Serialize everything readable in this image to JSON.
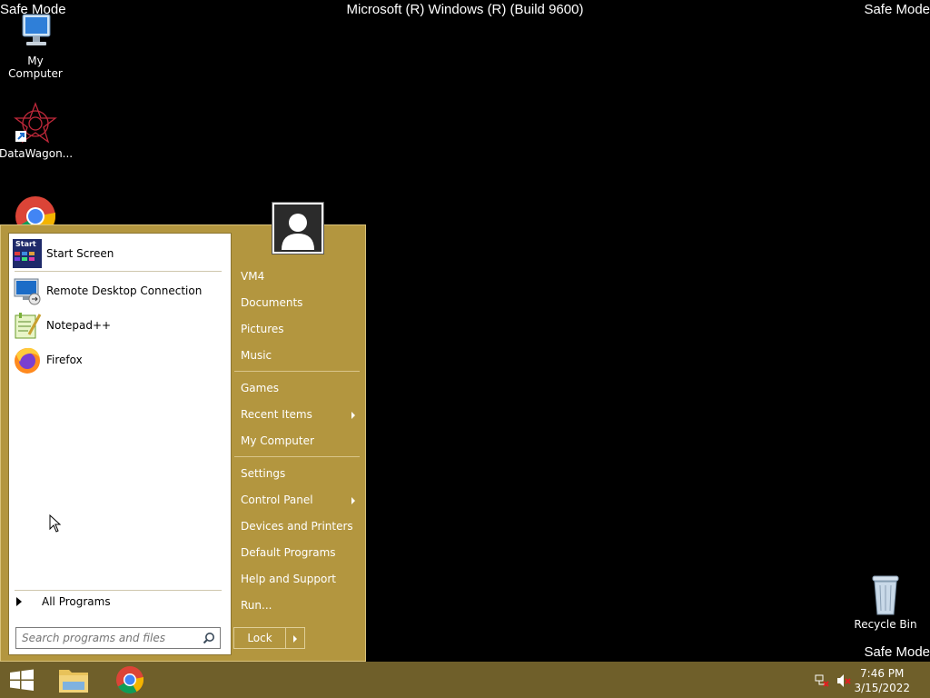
{
  "overlay": {
    "safe_mode_tl": "Safe Mode",
    "safe_mode_tr": "Safe Mode",
    "safe_mode_br": "Safe Mode",
    "os_title": "Microsoft (R) Windows (R) (Build 9600)"
  },
  "desktop": {
    "icons": [
      {
        "label": "My Computer",
        "icon": "computer-icon"
      },
      {
        "label": "DataWagon...",
        "icon": "datawagon-icon"
      },
      {
        "label": "Chrome",
        "icon": "chrome-icon"
      },
      {
        "label": "Recycle Bin",
        "icon": "recycle-bin-icon"
      }
    ]
  },
  "start_menu": {
    "pinned": [
      {
        "label": "Start Screen",
        "icon": "start-screen-icon"
      },
      {
        "label": "Remote Desktop Connection",
        "icon": "remote-desktop-icon"
      },
      {
        "label": "Notepad++",
        "icon": "notepadpp-icon"
      },
      {
        "label": "Firefox",
        "icon": "firefox-icon"
      }
    ],
    "start_icon_text": "Start",
    "all_programs": "All Programs",
    "search_placeholder": "Search programs and files",
    "right_items": [
      {
        "label": "VM4"
      },
      {
        "label": "Documents"
      },
      {
        "label": "Pictures"
      },
      {
        "label": "Music"
      },
      {
        "label": "Games"
      },
      {
        "label": "Recent Items",
        "submenu": true
      },
      {
        "label": "My Computer"
      },
      {
        "label": "Settings"
      },
      {
        "label": "Control Panel",
        "submenu": true
      },
      {
        "label": "Devices and Printers"
      },
      {
        "label": "Default Programs"
      },
      {
        "label": "Help and Support"
      },
      {
        "label": "Run..."
      }
    ],
    "lock_label": "Lock"
  },
  "taskbar": {
    "time": "7:46 PM",
    "date": "3/15/2022"
  },
  "colors": {
    "menu_bg": "#b3963f",
    "taskbar_bg": "#6f5f2a",
    "desktop_bg": "#000000"
  }
}
